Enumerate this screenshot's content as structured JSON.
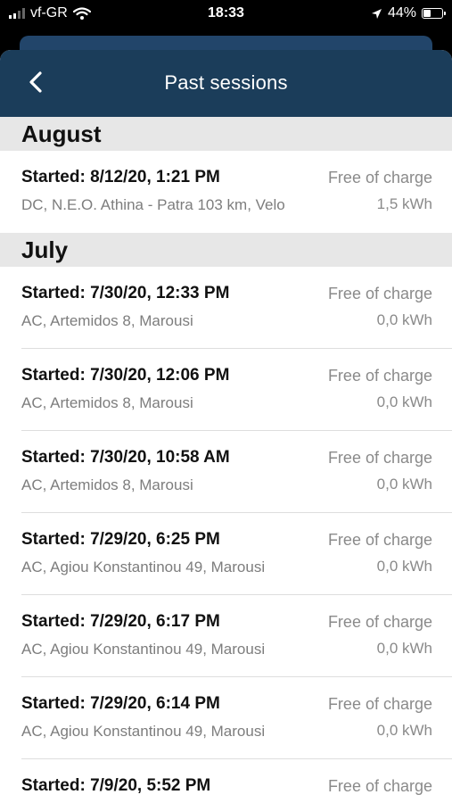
{
  "status_bar": {
    "carrier": "vf-GR",
    "time": "18:33",
    "battery": "44%",
    "battery_level": 0.44,
    "icons": [
      "cellular-signal-icon",
      "wifi-icon",
      "location-arrow-icon",
      "battery-icon"
    ]
  },
  "header": {
    "title": "Past sessions",
    "back_icon": "chevron-left-icon"
  },
  "colors": {
    "header_bg": "#1b3d5a",
    "section_bg": "#e7e7e7"
  },
  "sections": [
    {
      "title": "August",
      "items": [
        {
          "started": "Started: 8/12/20, 1:21 PM",
          "location": "DC, N.E.O. Athina - Patra 103 km, Velo",
          "price": "Free of charge",
          "energy": "1,5 kWh"
        }
      ]
    },
    {
      "title": "July",
      "items": [
        {
          "started": "Started: 7/30/20, 12:33 PM",
          "location": "AC, Artemidos 8, Marousi",
          "price": "Free of charge",
          "energy": "0,0 kWh"
        },
        {
          "started": "Started: 7/30/20, 12:06 PM",
          "location": "AC, Artemidos 8, Marousi",
          "price": "Free of charge",
          "energy": "0,0 kWh"
        },
        {
          "started": "Started: 7/30/20, 10:58 AM",
          "location": "AC, Artemidos 8, Marousi",
          "price": "Free of charge",
          "energy": "0,0 kWh"
        },
        {
          "started": "Started: 7/29/20, 6:25 PM",
          "location": "AC, Agiou Konstantinou 49, Marousi",
          "price": "Free of charge",
          "energy": "0,0 kWh"
        },
        {
          "started": "Started: 7/29/20, 6:17 PM",
          "location": "AC, Agiou Konstantinou 49, Marousi",
          "price": "Free of charge",
          "energy": "0,0 kWh"
        },
        {
          "started": "Started: 7/29/20, 6:14 PM",
          "location": "AC, Agiou Konstantinou 49, Marousi",
          "price": "Free of charge",
          "energy": "0,0 kWh"
        },
        {
          "started": "Started: 7/9/20, 5:52 PM",
          "location": "",
          "price": "Free of charge",
          "energy": ""
        }
      ]
    }
  ]
}
